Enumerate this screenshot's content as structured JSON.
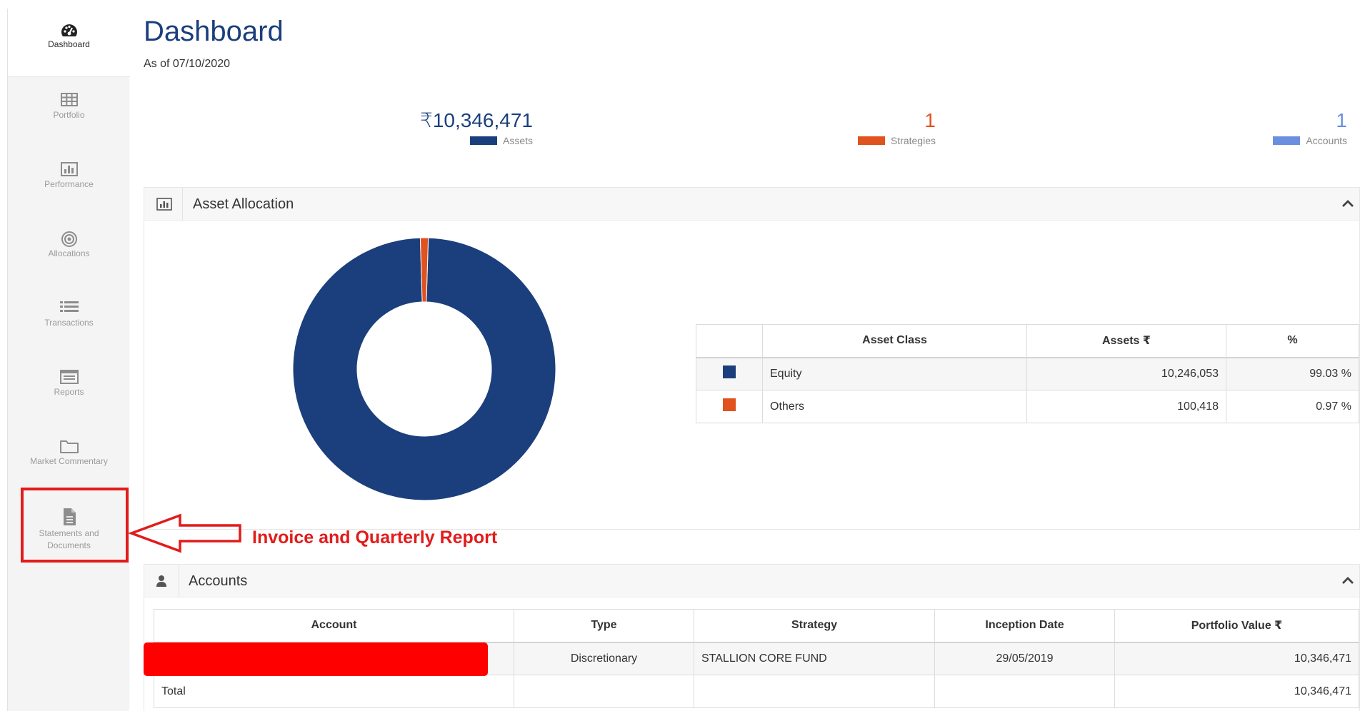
{
  "sidebar": {
    "items": [
      {
        "label": "Dashboard",
        "icon": "speedometer-icon"
      },
      {
        "label": "Portfolio",
        "icon": "table-grid-icon"
      },
      {
        "label": "Performance",
        "icon": "bar-chart-icon"
      },
      {
        "label": "Allocations",
        "icon": "target-icon"
      },
      {
        "label": "Transactions",
        "icon": "list-icon"
      },
      {
        "label": "Reports",
        "icon": "report-icon"
      },
      {
        "label": "Market Commentary",
        "icon": "folder-icon"
      },
      {
        "label": "Statements and Documents",
        "icon": "document-icon"
      }
    ]
  },
  "header": {
    "title": "Dashboard",
    "as_of": "As of 07/10/2020"
  },
  "kpis": [
    {
      "value": "₹10,346,471",
      "label": "Assets",
      "color": "#1b3f7c"
    },
    {
      "value": "1",
      "label": "Strategies",
      "color": "#e0521e"
    },
    {
      "value": "1",
      "label": "Accounts",
      "color": "#6b8fe0"
    }
  ],
  "asset_allocation": {
    "title": "Asset Allocation",
    "headers": [
      "",
      "Asset Class",
      "Assets ₹",
      "%"
    ],
    "rows": [
      {
        "color": "#1b3f7c",
        "asset_class": "Equity",
        "assets": "10,246,053",
        "pct": "99.03 %"
      },
      {
        "color": "#e0521e",
        "asset_class": "Others",
        "assets": "100,418",
        "pct": "0.97 %"
      }
    ]
  },
  "chart_data": {
    "type": "pie",
    "categories": [
      "Equity",
      "Others"
    ],
    "values": [
      99.03,
      0.97
    ],
    "colors": [
      "#1b3f7c",
      "#e0521e"
    ]
  },
  "accounts": {
    "title": "Accounts",
    "headers": [
      "Account",
      "Type",
      "Strategy",
      "Inception Date",
      "Portfolio Value ₹"
    ],
    "rows": [
      {
        "account": "",
        "type": "Discretionary",
        "strategy": "STALLION CORE FUND",
        "inception": "29/05/2019",
        "value": "10,346,471"
      }
    ],
    "total_label": "Total",
    "total_value": "10,346,471"
  },
  "annotation": {
    "text": "Invoice and Quarterly Report",
    "color": "#e21b1b"
  }
}
